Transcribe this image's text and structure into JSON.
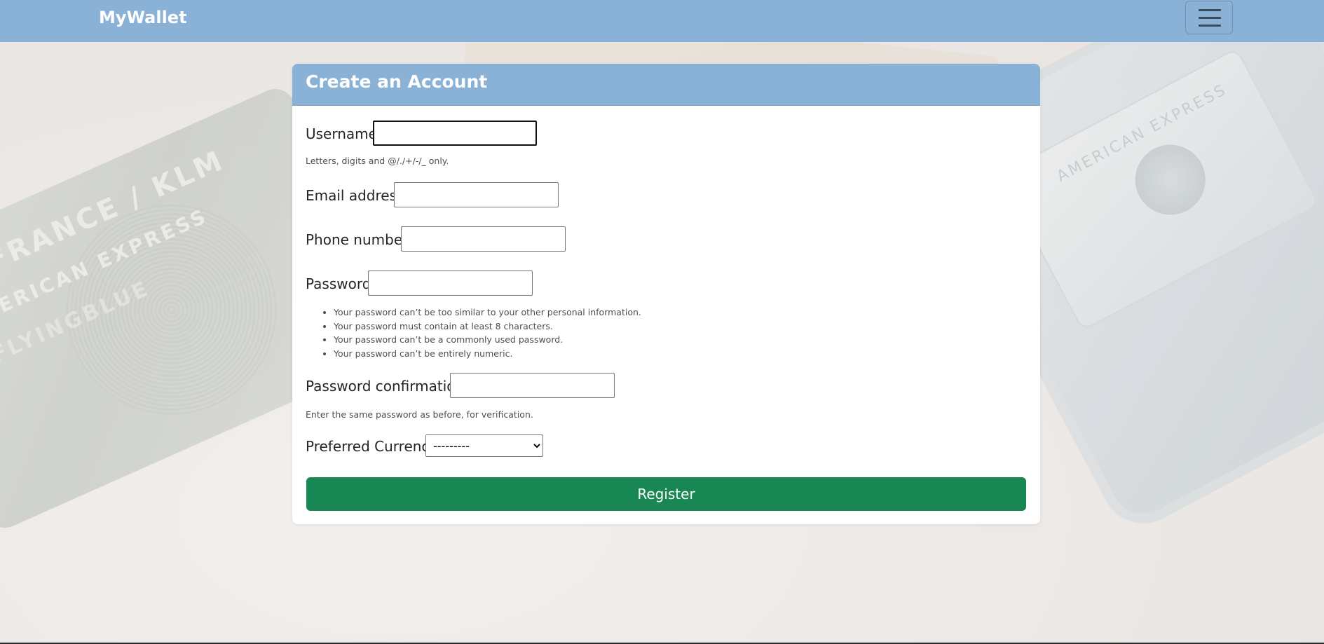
{
  "navbar": {
    "brand": "MyWallet",
    "toggler_icon": "hamburger-icon"
  },
  "background": {
    "card_text_1": "AIRFRANCE / KLM",
    "card_text_2": "AMERICAN EXPRESS",
    "card_text_3": "FLYINGBLUE",
    "phone_card_text": "AMERICAN EXPRESS"
  },
  "form": {
    "title": "Create an Account",
    "username": {
      "label": "Username",
      "value": "",
      "help": "Letters, digits and @/./+/-/_ only."
    },
    "email": {
      "label": "Email address",
      "value": ""
    },
    "phone": {
      "label": "Phone number",
      "value": ""
    },
    "password": {
      "label": "Password",
      "value": "",
      "rules": [
        "Your password can’t be too similar to your other personal information.",
        "Your password must contain at least 8 characters.",
        "Your password can’t be a commonly used password.",
        "Your password can’t be entirely numeric."
      ]
    },
    "password_confirmation": {
      "label": "Password confirmation",
      "value": "",
      "help": "Enter the same password as before, for verification."
    },
    "currency": {
      "label": "Preferred Currency",
      "selected": "---------"
    },
    "submit_label": "Register"
  },
  "colors": {
    "navbar": "#8ab1d6",
    "card_header": "#8ab1d6",
    "register_button": "#198754"
  }
}
